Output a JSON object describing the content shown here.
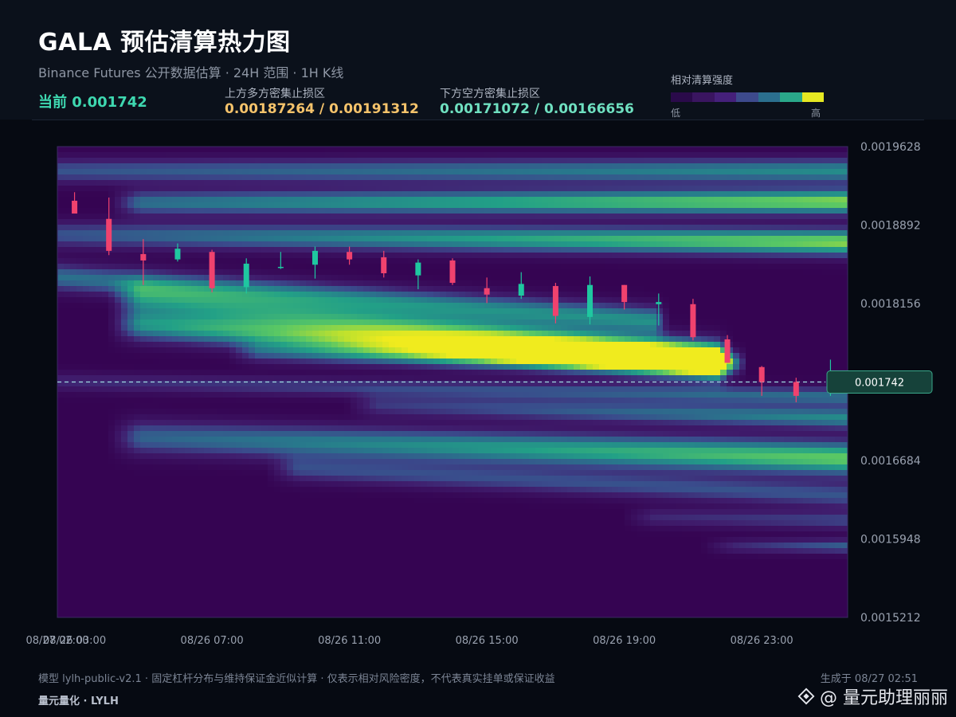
{
  "header": {
    "title": "GALA 预估清算热力图",
    "subtitle": "Binance Futures 公开数据估算 · 24H 范围 · 1H K线",
    "current_label": "当前 0.001742",
    "upper_label": "上方多方密集止损区",
    "upper_value": "0.00187264 / 0.00191312",
    "lower_label": "下方空方密集止损区",
    "lower_value": "0.00171072 / 0.00166656",
    "legend_title": "相对清算强度",
    "legend_low": "低",
    "legend_high": "高"
  },
  "colors": {
    "upper_zone": "#f5c36b",
    "lower_zone": "#6fe0c0",
    "current": "#3ed8b0",
    "up_candle": "#1fc7a0",
    "down_candle": "#f0426e",
    "price_line": "#9fd8e0",
    "legend": [
      "#2a0a4a",
      "#3a1560",
      "#45207a",
      "#3d4a8c",
      "#2b6f8e",
      "#2aa88a",
      "#e6e822"
    ]
  },
  "footer": {
    "note": "模型 lylh-public-v2.1 · 固定杠杆分布与维持保证金近似计算 · 仅表示相对风险密度，不代表真实挂单或保证收益",
    "brand": "量元量化 · LYLH",
    "generated": "生成于 08/27 02:51",
    "watermark": "@ 量元助理丽丽"
  },
  "chart_data": {
    "type": "heatmap",
    "title": "GALA 预估清算热力图",
    "y_ticks": [
      "0.0019628",
      "0.0018892",
      "0.0018156",
      "0.0017420",
      "0.0016684",
      "0.0015948",
      "0.0015212"
    ],
    "y_tick_labels": [
      "0.0019628",
      "0.0018892",
      "0.0018156",
      "",
      "0.0016684",
      "0.0015948",
      "0.0015212"
    ],
    "ylim": [
      0.0015212,
      0.0019628
    ],
    "x_ticks": [
      "08/26 03:00",
      "08/26 07:00",
      "08/26 11:00",
      "08/26 15:00",
      "08/26 19:00",
      "08/26 23:00",
      "08/27 02:00"
    ],
    "current_price": 0.001742,
    "current_price_label": "0.001742",
    "candles": [
      {
        "t": "08/26 03:00",
        "o": 0.001912,
        "h": 0.00192,
        "l": 0.001904,
        "c": 0.0019
      },
      {
        "t": "08/26 04:00",
        "o": 0.001895,
        "h": 0.001915,
        "l": 0.001861,
        "c": 0.001865
      },
      {
        "t": "08/26 05:00",
        "o": 0.001862,
        "h": 0.001876,
        "l": 0.001833,
        "c": 0.001856
      },
      {
        "t": "08/26 06:00",
        "o": 0.001857,
        "h": 0.001872,
        "l": 0.001855,
        "c": 0.001867
      },
      {
        "t": "08/26 07:00",
        "o": 0.001864,
        "h": 0.001866,
        "l": 0.001826,
        "c": 0.00183
      },
      {
        "t": "08/26 08:00",
        "o": 0.001831,
        "h": 0.001858,
        "l": 0.001825,
        "c": 0.001853
      },
      {
        "t": "08/26 09:00",
        "o": 0.001849,
        "h": 0.001864,
        "l": 0.001848,
        "c": 0.00185
      },
      {
        "t": "08/26 10:00",
        "o": 0.001852,
        "h": 0.001869,
        "l": 0.001839,
        "c": 0.001865
      },
      {
        "t": "08/26 11:00",
        "o": 0.001864,
        "h": 0.001869,
        "l": 0.001852,
        "c": 0.001857
      },
      {
        "t": "08/26 12:00",
        "o": 0.001859,
        "h": 0.001865,
        "l": 0.00184,
        "c": 0.001844
      },
      {
        "t": "08/26 13:00",
        "o": 0.001842,
        "h": 0.001857,
        "l": 0.001829,
        "c": 0.001854
      },
      {
        "t": "08/26 14:00",
        "o": 0.001856,
        "h": 0.001858,
        "l": 0.001833,
        "c": 0.001835
      },
      {
        "t": "08/26 15:00",
        "o": 0.00183,
        "h": 0.00184,
        "l": 0.001816,
        "c": 0.001824
      },
      {
        "t": "08/26 16:00",
        "o": 0.001823,
        "h": 0.001845,
        "l": 0.00182,
        "c": 0.001834
      },
      {
        "t": "08/26 17:00",
        "o": 0.001832,
        "h": 0.001835,
        "l": 0.001797,
        "c": 0.001804
      },
      {
        "t": "08/26 18:00",
        "o": 0.001803,
        "h": 0.001841,
        "l": 0.001796,
        "c": 0.001833
      },
      {
        "t": "08/26 19:00",
        "o": 0.001833,
        "h": 0.001833,
        "l": 0.00181,
        "c": 0.001817
      },
      {
        "t": "08/26 20:00",
        "o": 0.001815,
        "h": 0.001825,
        "l": 0.001795,
        "c": 0.001817
      },
      {
        "t": "08/26 21:00",
        "o": 0.001815,
        "h": 0.00182,
        "l": 0.001781,
        "c": 0.001784
      },
      {
        "t": "08/26 22:00",
        "o": 0.001782,
        "h": 0.001786,
        "l": 0.00176,
        "c": 0.00176
      },
      {
        "t": "08/26 23:00",
        "o": 0.001756,
        "h": 0.001757,
        "l": 0.001729,
        "c": 0.001742
      },
      {
        "t": "08/27 00:00",
        "o": 0.001742,
        "h": 0.001746,
        "l": 0.001723,
        "c": 0.001729
      },
      {
        "t": "08/27 01:00",
        "o": 0.001732,
        "h": 0.001763,
        "l": 0.001729,
        "c": 0.00174
      }
    ],
    "heat_bands": [
      {
        "x0": 0.0,
        "x1": 1.0,
        "y_start": 0.00194,
        "y_end": 0.00194,
        "width": 8e-06,
        "i0": 0.35,
        "i1": 0.55
      },
      {
        "x0": 0.1,
        "x1": 1.0,
        "y_start": 0.00191,
        "y_end": 0.001911,
        "width": 8e-06,
        "i0": 0.45,
        "i1": 0.85
      },
      {
        "x0": 0.0,
        "x1": 1.0,
        "y_start": 0.00188,
        "y_end": 0.001873,
        "width": 8.5e-06,
        "i0": 0.35,
        "i1": 0.85
      },
      {
        "x0": 0.0,
        "x1": 0.75,
        "y_start": 0.00184,
        "y_end": 0.0018,
        "width": 9e-06,
        "i0": 0.45,
        "i1": 0.55
      },
      {
        "x0": 0.1,
        "x1": 0.83,
        "y_start": 0.00182,
        "y_end": 0.001765,
        "width": 1.1e-05,
        "i0": 0.5,
        "i1": 0.6
      },
      {
        "x0": 0.1,
        "x1": 0.83,
        "y_start": 0.001795,
        "y_end": 0.00176,
        "width": 1e-05,
        "i0": 0.55,
        "i1": 1.0
      },
      {
        "x0": 0.25,
        "x1": 0.85,
        "y_start": 0.00177,
        "y_end": 0.00176,
        "width": 7e-06,
        "i0": 0.3,
        "i1": 0.65
      },
      {
        "x0": 0.0,
        "x1": 1.0,
        "y_start": 0.001742,
        "y_end": 0.001728,
        "width": 6e-06,
        "i0": 0.2,
        "i1": 0.45
      },
      {
        "x0": 0.4,
        "x1": 1.0,
        "y_start": 0.00172,
        "y_end": 0.001708,
        "width": 7e-06,
        "i0": 0.25,
        "i1": 0.55
      },
      {
        "x0": 0.1,
        "x1": 1.0,
        "y_start": 0.00169,
        "y_end": 0.00167,
        "width": 1.1e-05,
        "i0": 0.4,
        "i1": 0.8
      },
      {
        "x0": 0.3,
        "x1": 1.0,
        "y_start": 0.00166,
        "y_end": 0.001635,
        "width": 8e-06,
        "i0": 0.3,
        "i1": 0.35
      },
      {
        "x0": 0.75,
        "x1": 1.0,
        "y_start": 0.001615,
        "y_end": 0.001612,
        "width": 6e-06,
        "i0": 0.2,
        "i1": 0.3
      },
      {
        "x0": 0.85,
        "x1": 1.0,
        "y_start": 0.001588,
        "y_end": 0.001588,
        "width": 4.5e-06,
        "i0": 0.2,
        "i1": 0.4
      }
    ]
  }
}
